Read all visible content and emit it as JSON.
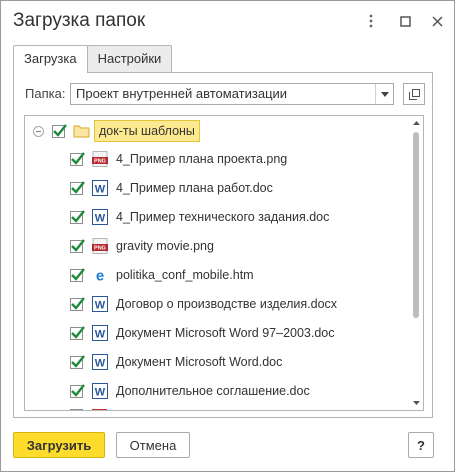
{
  "window": {
    "title": "Загрузка папок",
    "more_icon": "more-vertical-icon",
    "maximize_icon": "maximize-icon",
    "close_icon": "close-icon"
  },
  "tabs": [
    {
      "label": "Загрузка",
      "active": true
    },
    {
      "label": "Настройки",
      "active": false
    }
  ],
  "folder": {
    "label": "Папка:",
    "value": "Проект внутренней автоматизации"
  },
  "tree": {
    "root": {
      "label": "док-ты шаблоны",
      "checked": true,
      "expanded": true,
      "icon": "folder-icon"
    },
    "items": [
      {
        "label": "4_Пример плана проекта.png",
        "checked": true,
        "icon": "png-icon"
      },
      {
        "label": "4_Пример плана работ.doc",
        "checked": true,
        "icon": "word-icon"
      },
      {
        "label": "4_Пример технического задания.doc",
        "checked": true,
        "icon": "word-icon"
      },
      {
        "label": "gravity movie.png",
        "checked": true,
        "icon": "png-icon"
      },
      {
        "label": "politika_conf_mobile.htm",
        "checked": true,
        "icon": "edge-icon"
      },
      {
        "label": "Договор о производстве изделия.docx",
        "checked": true,
        "icon": "word-icon"
      },
      {
        "label": "Документ Microsoft Word 97–2003.doc",
        "checked": true,
        "icon": "word-icon"
      },
      {
        "label": "Документ Microsoft Word.doc",
        "checked": true,
        "icon": "word-icon"
      },
      {
        "label": "Дополнительное соглашение.doc",
        "checked": true,
        "icon": "word-icon"
      }
    ]
  },
  "buttons": {
    "upload": "Загрузить",
    "cancel": "Отмена",
    "help": "?"
  },
  "colors": {
    "accent_button": "#fddc2c",
    "checkmark": "#1d8a3a",
    "selection": "#fde98f",
    "word_blue": "#2b5797",
    "png_red": "#b6282f"
  }
}
